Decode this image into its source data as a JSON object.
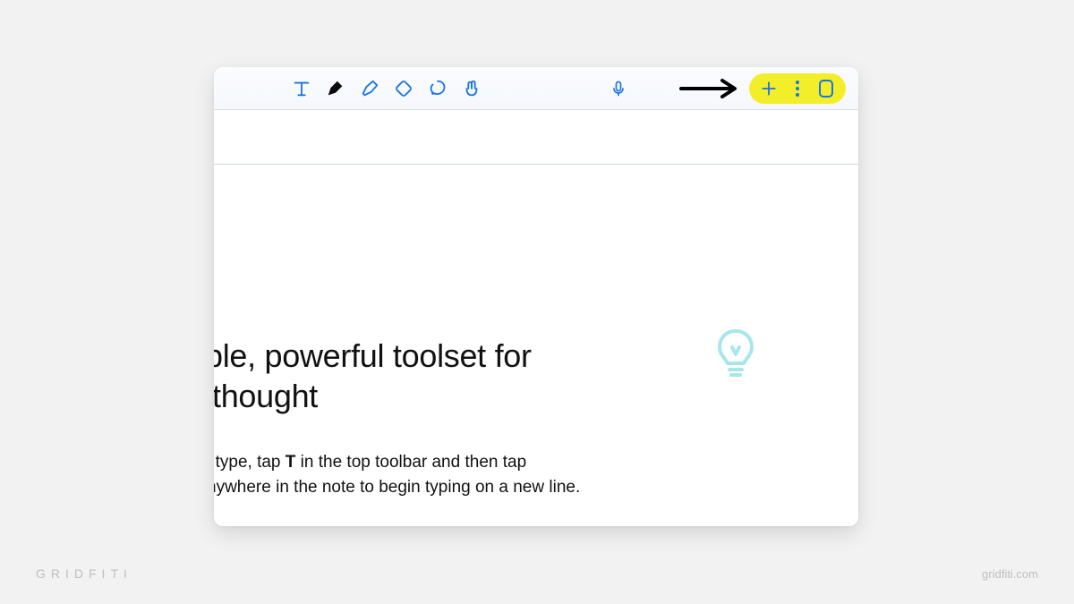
{
  "toolbar": {
    "tools": [
      "text",
      "pen",
      "highlighter",
      "eraser",
      "lasso",
      "fingers"
    ],
    "mic": "microphone",
    "right": [
      "add",
      "more",
      "page-options"
    ]
  },
  "document": {
    "headline_line1": "ple, powerful toolset for",
    "headline_line2": " thought",
    "body_line1_prefix": ") type, tap ",
    "body_line1_bold": "T",
    "body_line1_suffix": " in the top toolbar and then tap",
    "body_line2": "﻿nywhere in the note to begin typing on a new line."
  },
  "brand": {
    "logo_text": "GRIDFITI",
    "url_text": "gridfiti.com"
  }
}
